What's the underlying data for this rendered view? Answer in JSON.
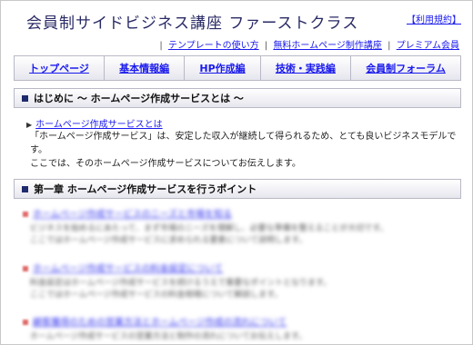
{
  "header": {
    "site_title": "会員制サイドビジネス講座 ファーストクラス",
    "terms_link": "【利用規約】",
    "sub_links": [
      "テンプレートの使い方",
      "無料ホームページ制作講座",
      "プレミアム会員"
    ],
    "separator": "|"
  },
  "nav": {
    "items": [
      "トップページ",
      "基本情報編",
      "HP作成編",
      "技術・実践編",
      "会員制フォーラム"
    ]
  },
  "intro_section": {
    "heading": "はじめに ～ ホームページ作成サービスとは ～",
    "link": "ホームページ作成サービスとは",
    "text_line1": "「ホームページ作成サービス」は、安定した収入が継続して得られるため、とても良いビジネスモデルです。",
    "text_line2": "ここでは、そのホームページ作成サービスについてお伝えします。"
  },
  "chapter_section": {
    "heading": "第一章 ホームページ作成サービスを行うポイント",
    "items": [
      {
        "link": "ホームページ作成サービスのニーズと市場を知る",
        "line1": "ビジネスを始めるにあたって、まず市場のニーズを理解し、必要な準備を整えることが大切です。",
        "line2": "ここではホームページ作成サービスに求められる要素について説明します。"
      },
      {
        "link": "ホームページ作成サービスの料金設定について",
        "line1": "料金設定はホームページ作成サービスを続けるうえで重要なポイントとなります。",
        "line2": "ここではホームページ作成サービスの料金相場について解説します。"
      },
      {
        "link": "顧客獲得のための営業方法とホームページ作成の流れについて",
        "line1": "ホームページ作成サービスの営業方法と制作の流れについてお伝えします。"
      }
    ]
  }
}
